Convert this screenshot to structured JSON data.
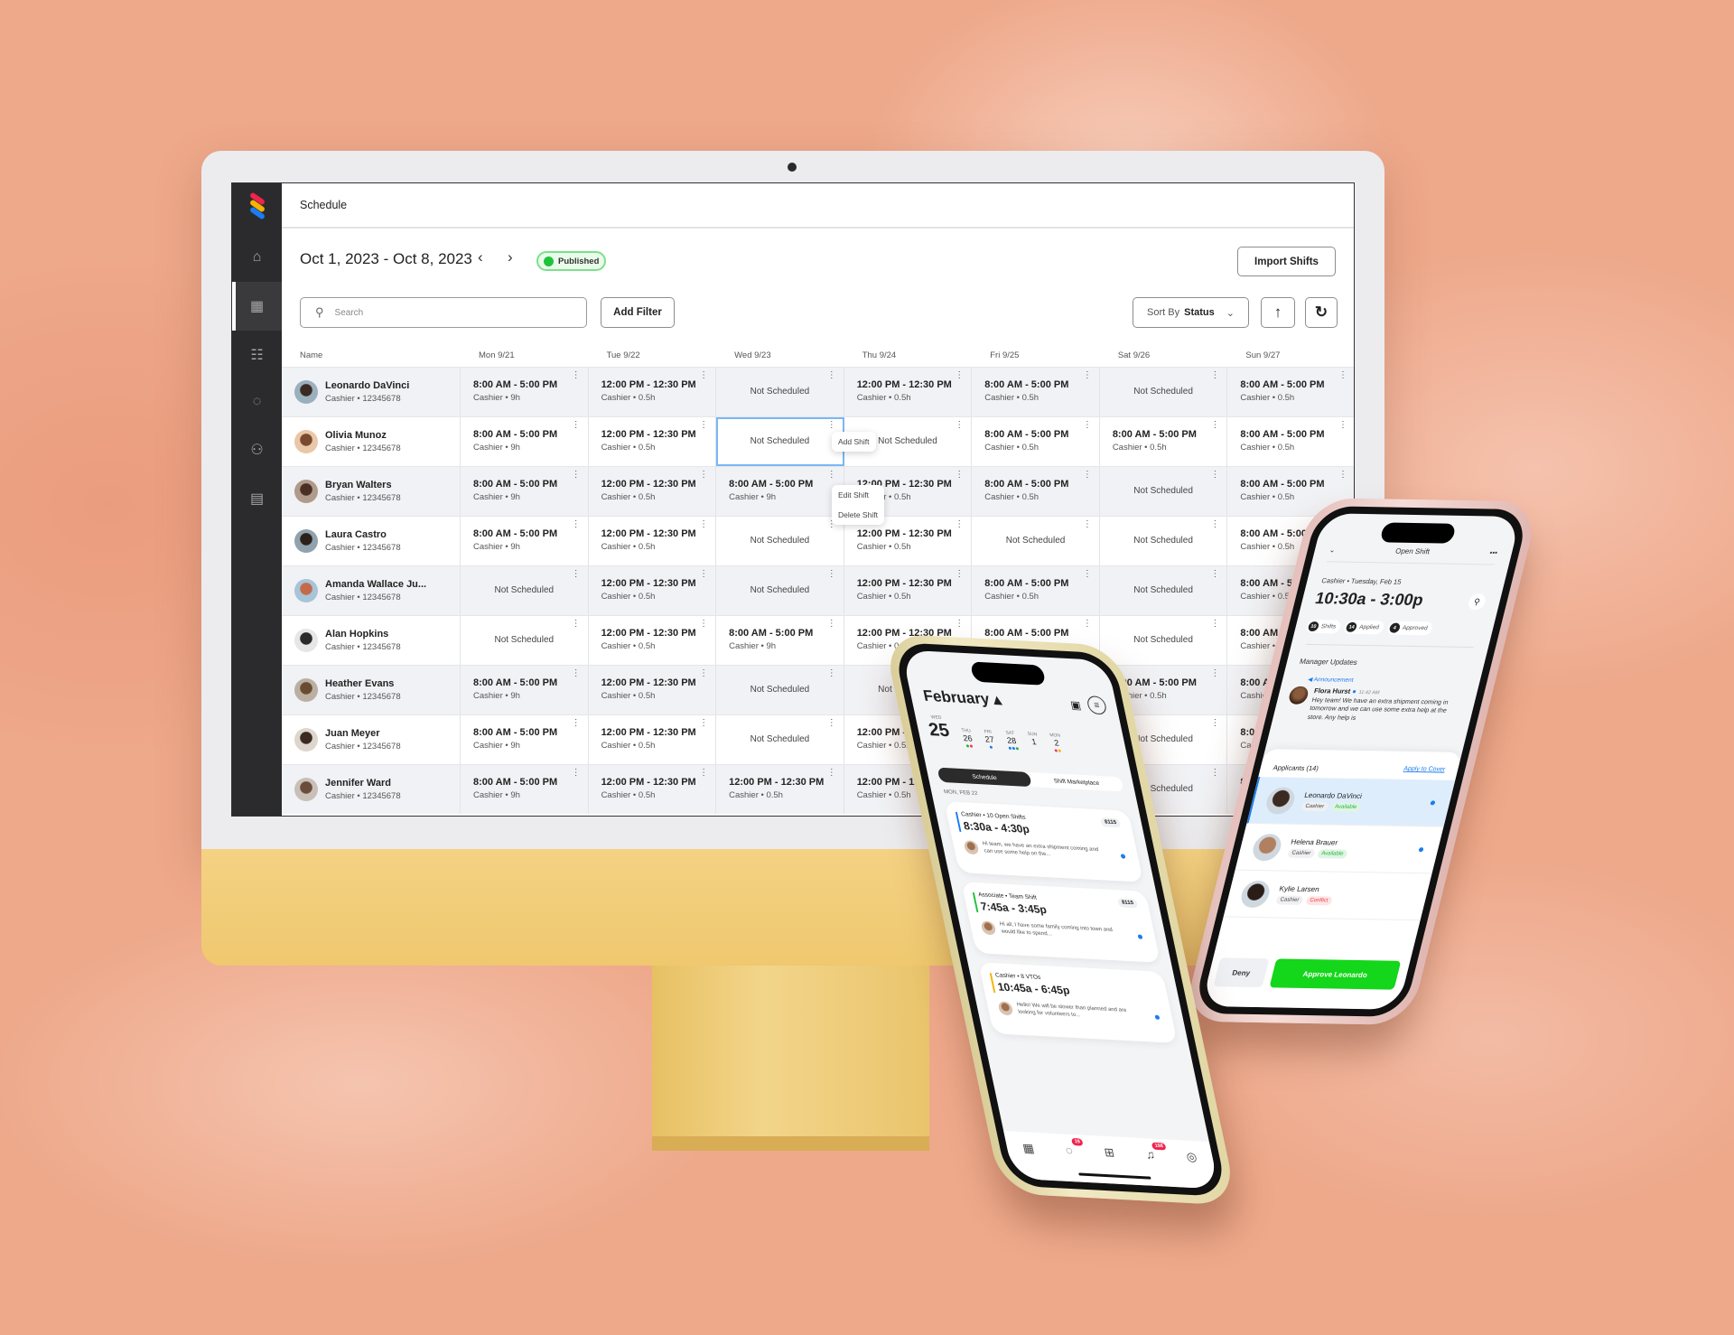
{
  "app": {
    "header_title": "Schedule",
    "logo": "stacked-stripes-logo"
  },
  "sidebar": {
    "items": [
      {
        "icon": "home-icon"
      },
      {
        "icon": "calendar-icon",
        "active": true
      },
      {
        "icon": "clipboard-icon"
      },
      {
        "icon": "chat-icon"
      },
      {
        "icon": "users-icon"
      },
      {
        "icon": "document-icon"
      }
    ]
  },
  "toolbar": {
    "date_range": "Oct 1, 2023 - Oct 8, 2023",
    "prev": "‹",
    "next": "›",
    "status": "Published",
    "import_label": "Import Shifts",
    "search_placeholder": "Search",
    "add_filter": "Add Filter",
    "sort_prefix": "Sort By",
    "sort_value": "Status",
    "sort_direction": "↑",
    "refresh": "↻"
  },
  "colors": {
    "accent": "#1c7cf0",
    "published": "#1fc33b",
    "approve": "#14d61a",
    "conflict": "#f03a4f",
    "sidebar": "#2b2b2e"
  },
  "table": {
    "name_header": "Name",
    "days": [
      "Mon 9/21",
      "Tue 9/22",
      "Wed 9/23",
      "Thu 9/24",
      "Fri 9/25",
      "Sat 9/26",
      "Sun 9/27"
    ],
    "rows": [
      {
        "name": "Leonardo DaVinci",
        "sub": "Cashier • 12345678",
        "cells": [
          {
            "t": "8:00 AM - 5:00 PM",
            "d": "Cashier • 9h"
          },
          {
            "t": "12:00 PM - 12:30 PM",
            "d": "Cashier • 0.5h"
          },
          {
            "ns": "Not Scheduled"
          },
          {
            "t": "12:00 PM - 12:30 PM",
            "d": "Cashier • 0.5h"
          },
          {
            "t": "8:00 AM - 5:00 PM",
            "d": "Cashier • 0.5h"
          },
          {
            "ns": "Not Scheduled"
          },
          {
            "t": "8:00 AM - 5:00 PM",
            "d": "Cashier • 0.5h"
          }
        ]
      },
      {
        "name": "Olivia Munoz",
        "sub": "Cashier • 12345678",
        "cells": [
          {
            "t": "8:00 AM - 5:00 PM",
            "d": "Cashier • 9h"
          },
          {
            "t": "12:00 PM - 12:30 PM",
            "d": "Cashier • 0.5h"
          },
          {
            "ns": "Not Scheduled",
            "selected": true
          },
          {
            "ns": "Not Scheduled"
          },
          {
            "t": "8:00 AM - 5:00 PM",
            "d": "Cashier • 0.5h"
          },
          {
            "t": "8:00 AM - 5:00 PM",
            "d": "Cashier • 0.5h"
          },
          {
            "t": "8:00 AM - 5:00 PM",
            "d": "Cashier • 0.5h"
          }
        ]
      },
      {
        "name": "Bryan Walters",
        "sub": "Cashier • 12345678",
        "cells": [
          {
            "t": "8:00 AM - 5:00 PM",
            "d": "Cashier • 9h"
          },
          {
            "t": "12:00 PM - 12:30 PM",
            "d": "Cashier • 0.5h"
          },
          {
            "t": "8:00 AM - 5:00 PM",
            "d": "Cashier • 9h"
          },
          {
            "t": "12:00 PM - 12:30 PM",
            "d": "Cashier • 0.5h"
          },
          {
            "t": "8:00 AM - 5:00 PM",
            "d": "Cashier • 0.5h"
          },
          {
            "ns": "Not Scheduled"
          },
          {
            "t": "8:00 AM - 5:00 PM",
            "d": "Cashier • 0.5h"
          }
        ]
      },
      {
        "name": "Laura Castro",
        "sub": "Cashier • 12345678",
        "cells": [
          {
            "t": "8:00 AM - 5:00 PM",
            "d": "Cashier • 9h"
          },
          {
            "t": "12:00 PM - 12:30 PM",
            "d": "Cashier • 0.5h"
          },
          {
            "ns": "Not Scheduled"
          },
          {
            "t": "12:00 PM - 12:30 PM",
            "d": "Cashier • 0.5h"
          },
          {
            "ns": "Not Scheduled"
          },
          {
            "ns": "Not Scheduled"
          },
          {
            "t": "8:00 AM - 5:00 PM",
            "d": "Cashier • 0.5h"
          }
        ]
      },
      {
        "name": "Amanda Wallace Ju...",
        "sub": "Cashier • 12345678",
        "cells": [
          {
            "ns": "Not Scheduled"
          },
          {
            "t": "12:00 PM - 12:30 PM",
            "d": "Cashier • 0.5h"
          },
          {
            "ns": "Not Scheduled"
          },
          {
            "t": "12:00 PM - 12:30 PM",
            "d": "Cashier • 0.5h"
          },
          {
            "t": "8:00 AM - 5:00 PM",
            "d": "Cashier • 0.5h"
          },
          {
            "ns": "Not Scheduled"
          },
          {
            "t": "8:00 AM - 5:00 PM",
            "d": "Cashier • 0.5h"
          }
        ]
      },
      {
        "name": "Alan Hopkins",
        "sub": "Cashier • 12345678",
        "cells": [
          {
            "ns": "Not Scheduled"
          },
          {
            "t": "12:00 PM - 12:30 PM",
            "d": "Cashier • 0.5h"
          },
          {
            "t": "8:00 AM - 5:00 PM",
            "d": "Cashier • 9h"
          },
          {
            "t": "12:00 PM - 12:30 PM",
            "d": "Cashier • 0.5h"
          },
          {
            "t": "8:00 AM - 5:00 PM",
            "d": "Cashier • 0.5h"
          },
          {
            "ns": "Not Scheduled"
          },
          {
            "t": "8:00 AM - 5:00 PM",
            "d": "Cashier • 0.5h"
          }
        ]
      },
      {
        "name": "Heather Evans",
        "sub": "Cashier • 12345678",
        "cells": [
          {
            "t": "8:00 AM - 5:00 PM",
            "d": "Cashier • 9h"
          },
          {
            "t": "12:00 PM - 12:30 PM",
            "d": "Cashier • 0.5h"
          },
          {
            "ns": "Not Scheduled"
          },
          {
            "ns": "Not Scheduled"
          },
          {
            "t": "8:00 AM - 5:00 PM",
            "d": "Cashier • 0.5h"
          },
          {
            "t": "8:00 AM - 5:00 PM",
            "d": "Cashier • 0.5h"
          },
          {
            "t": "8:00 AM - 5:00 PM",
            "d": "Cashier • 0.5h"
          }
        ]
      },
      {
        "name": "Juan Meyer",
        "sub": "Cashier • 12345678",
        "cells": [
          {
            "t": "8:00 AM - 5:00 PM",
            "d": "Cashier • 9h"
          },
          {
            "t": "12:00 PM - 12:30 PM",
            "d": "Cashier • 0.5h"
          },
          {
            "ns": "Not Scheduled"
          },
          {
            "t": "12:00 PM - 12:30 PM",
            "d": "Cashier • 0.5h"
          },
          {
            "t": "8:00 AM - 5:00 PM",
            "d": "Cashier • 0.5h"
          },
          {
            "ns": "Not Scheduled"
          },
          {
            "t": "8:00 AM - 5:00 PM",
            "d": "Cashier • 0.5h"
          }
        ]
      },
      {
        "name": "Jennifer Ward",
        "sub": "Cashier • 12345678",
        "cells": [
          {
            "t": "8:00 AM - 5:00 PM",
            "d": "Cashier • 9h"
          },
          {
            "t": "12:00 PM - 12:30 PM",
            "d": "Cashier • 0.5h"
          },
          {
            "t": "12:00 PM - 12:30 PM",
            "d": "Cashier • 0.5h"
          },
          {
            "t": "12:00 PM - 12:30 PM",
            "d": "Cashier • 0.5h"
          },
          {
            "t": "8:00 AM - 5:00 PM",
            "d": "Cashier • 0.5h"
          },
          {
            "ns": "Not Scheduled"
          },
          {
            "t": "8:00 AM - 5:00 PM",
            "d": "Cashier • 0.5h"
          }
        ]
      }
    ]
  },
  "context_menu": {
    "add": "Add Shift",
    "edit": "Edit Shift",
    "delete": "Delete Shift"
  },
  "phone_schedule": {
    "month": "February ▴",
    "days": [
      {
        "dow": "WED",
        "num": "25",
        "today": true,
        "dots": []
      },
      {
        "dow": "THU",
        "num": "26",
        "dots": [
          "#22b33c",
          "#f03a4f"
        ]
      },
      {
        "dow": "FRI",
        "num": "27",
        "dots": [
          "#1c7cf0"
        ]
      },
      {
        "dow": "SAT",
        "num": "28",
        "dots": [
          "#1c7cf0",
          "#1c7cf0",
          "#22b33c"
        ]
      },
      {
        "dow": "SUN",
        "num": "1",
        "dots": []
      },
      {
        "dow": "MON",
        "num": "2",
        "dots": [
          "#f03a4f",
          "#f5b301"
        ]
      }
    ],
    "tabs": [
      "Schedule",
      "Shift Marketplace"
    ],
    "date_label": "MON, FEB 22",
    "cards": [
      {
        "role": "Cashier • 10 Open Shifts",
        "time": "8:30a - 4:30p",
        "price": "$115",
        "msg": "Hi team, we have an extra shipment coming and can use some help on the...",
        "color": "#1c7cf0"
      },
      {
        "role": "Associate • Team Shift",
        "time": "7:45a - 3:45p",
        "price": "$115",
        "msg": "Hi all, I have some family coming into town and would like to spend...",
        "color": "#22c03a"
      },
      {
        "role": "Cashier • 8 VTOs",
        "time": "10:45a - 6:45p",
        "price": "",
        "msg": "Hello! We will be slower than planned and are looking for volunteers to...",
        "color": "#f5b301"
      }
    ],
    "nav": [
      {
        "icon": "calendar-icon",
        "glyph": "▦",
        "badge": ""
      },
      {
        "icon": "chat-icon",
        "glyph": "◌",
        "badge": "19"
      },
      {
        "icon": "add-icon",
        "glyph": "⊞",
        "badge": ""
      },
      {
        "icon": "bell-icon",
        "glyph": "♫",
        "badge": "198"
      },
      {
        "icon": "profile-icon",
        "glyph": "◎",
        "badge": ""
      }
    ]
  },
  "phone_open_shift": {
    "title": "Open Shift",
    "back": "⌄",
    "more": "•••",
    "role_date": "Cashier • Tuesday, Feb 15",
    "time": "10:30a - 3:00p",
    "chips": [
      {
        "n": "10",
        "label": "Shifts"
      },
      {
        "n": "14",
        "label": "Applied"
      },
      {
        "n": "4",
        "label": "Approved"
      }
    ],
    "updates_title": "Manager Updates",
    "announcement": "Announcement",
    "author": "Flora Hurst",
    "post_time": "11:42 AM",
    "message": "Hey team! We have an extra shipment coming in tomorrow and we can use some extra help at the store. Any help is",
    "applicants_title": "Applicants (14)",
    "apply_cover": "Apply to Cover",
    "applicants": [
      {
        "name": "Leonardo DaVinci",
        "role": "Cashier",
        "status": "Available",
        "ok": true,
        "selected": true
      },
      {
        "name": "Helena Brauer",
        "role": "Cashier",
        "status": "Available",
        "ok": true
      },
      {
        "name": "Kylie Larsen",
        "role": "Cashier",
        "status": "Conflict",
        "ok": false
      }
    ],
    "deny": "Deny",
    "approve": "Approve Leonardo"
  }
}
